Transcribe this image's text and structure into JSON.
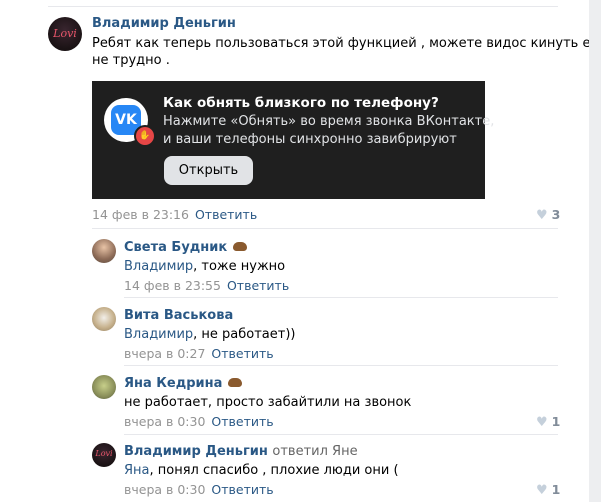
{
  "post": {
    "author": "Владимир Деньгин",
    "avatar_text": "Lovi",
    "text_line1": "Ребят как теперь пользоваться этой функцией , можете видос кинуть если",
    "text_line2": "не трудно .",
    "card": {
      "title": "Как обнять близкого по телефону?",
      "line1": "Нажмите «Обнять» во время звонка ВКонтакте,",
      "line2": "и ваши телефоны синхронно завибрируют",
      "button": "Открыть",
      "vk_logo": "VK",
      "badge_icon": "hand-wave-icon"
    },
    "date": "14 фев в 23:16",
    "reply_label": "Ответить",
    "likes": "3"
  },
  "comments": [
    {
      "author": "Света Будник",
      "reply_to_link": "Владимир",
      "text": ", тоже нужно",
      "date": "14 фев в 23:55",
      "reply_label": "Ответить",
      "likes": ""
    },
    {
      "author": "Вита Васькова",
      "reply_to_link": "Владимир",
      "text": ", не работает))",
      "date": "вчера в 0:27",
      "reply_label": "Ответить",
      "likes": ""
    },
    {
      "author": "Яна Кедрина",
      "reply_to_link": "",
      "text": "не работает, просто забайтили на звонок",
      "date": "вчера в 0:30",
      "reply_label": "Ответить",
      "likes": "1"
    },
    {
      "author": "Владимир Деньгин",
      "replied_to": "ответил Яне",
      "reply_to_link": "Яна",
      "text": ", понял спасибо , плохие люди они (",
      "date": "вчера в 0:30",
      "reply_label": "Ответить",
      "likes": "1",
      "avatar_text": "Lovi"
    }
  ],
  "colors": {
    "link": "#2a5885",
    "meta": "#939393",
    "card_bg": "#1f1f1f",
    "vk_blue": "#2787f5",
    "badge_red": "#e64646"
  }
}
